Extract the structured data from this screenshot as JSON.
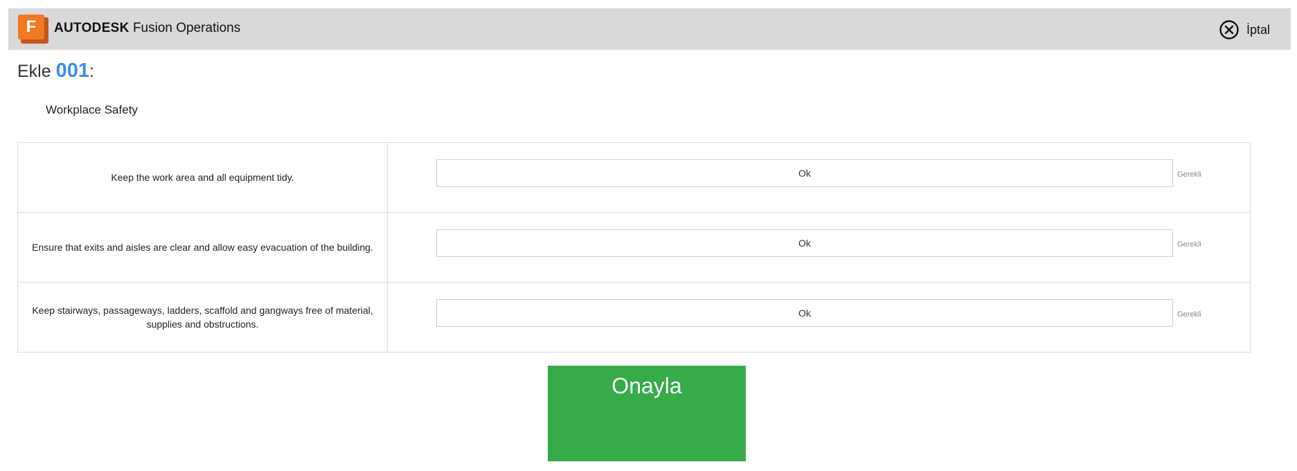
{
  "header": {
    "brand_strong": "AUTODESK",
    "brand_product": "Fusion Operations",
    "logo_letter": "F",
    "cancel_label": "İptal",
    "cancel_icon": "circle-x-icon"
  },
  "page": {
    "title_prefix": "Ekle",
    "title_number": "001",
    "title_suffix": ":",
    "section_title": "Workplace Safety"
  },
  "checklist": [
    {
      "question": "Keep the work area and all equipment tidy.",
      "answer": "Ok",
      "required_label": "Gerekli"
    },
    {
      "question": "Ensure that exits and aisles are clear and allow easy evacuation of the building.",
      "answer": "Ok",
      "required_label": "Gerekli"
    },
    {
      "question": "Keep stairways, passageways, ladders, scaffold and gangways free of material, supplies and obstructions.",
      "answer": "Ok",
      "required_label": "Gerekli"
    }
  ],
  "actions": {
    "confirm_label": "Onayla"
  },
  "colors": {
    "header_bg": "#d9d9d9",
    "logo_orange": "#f07a22",
    "accent_blue": "#3d8de6",
    "confirm_green": "#37ab4a"
  }
}
